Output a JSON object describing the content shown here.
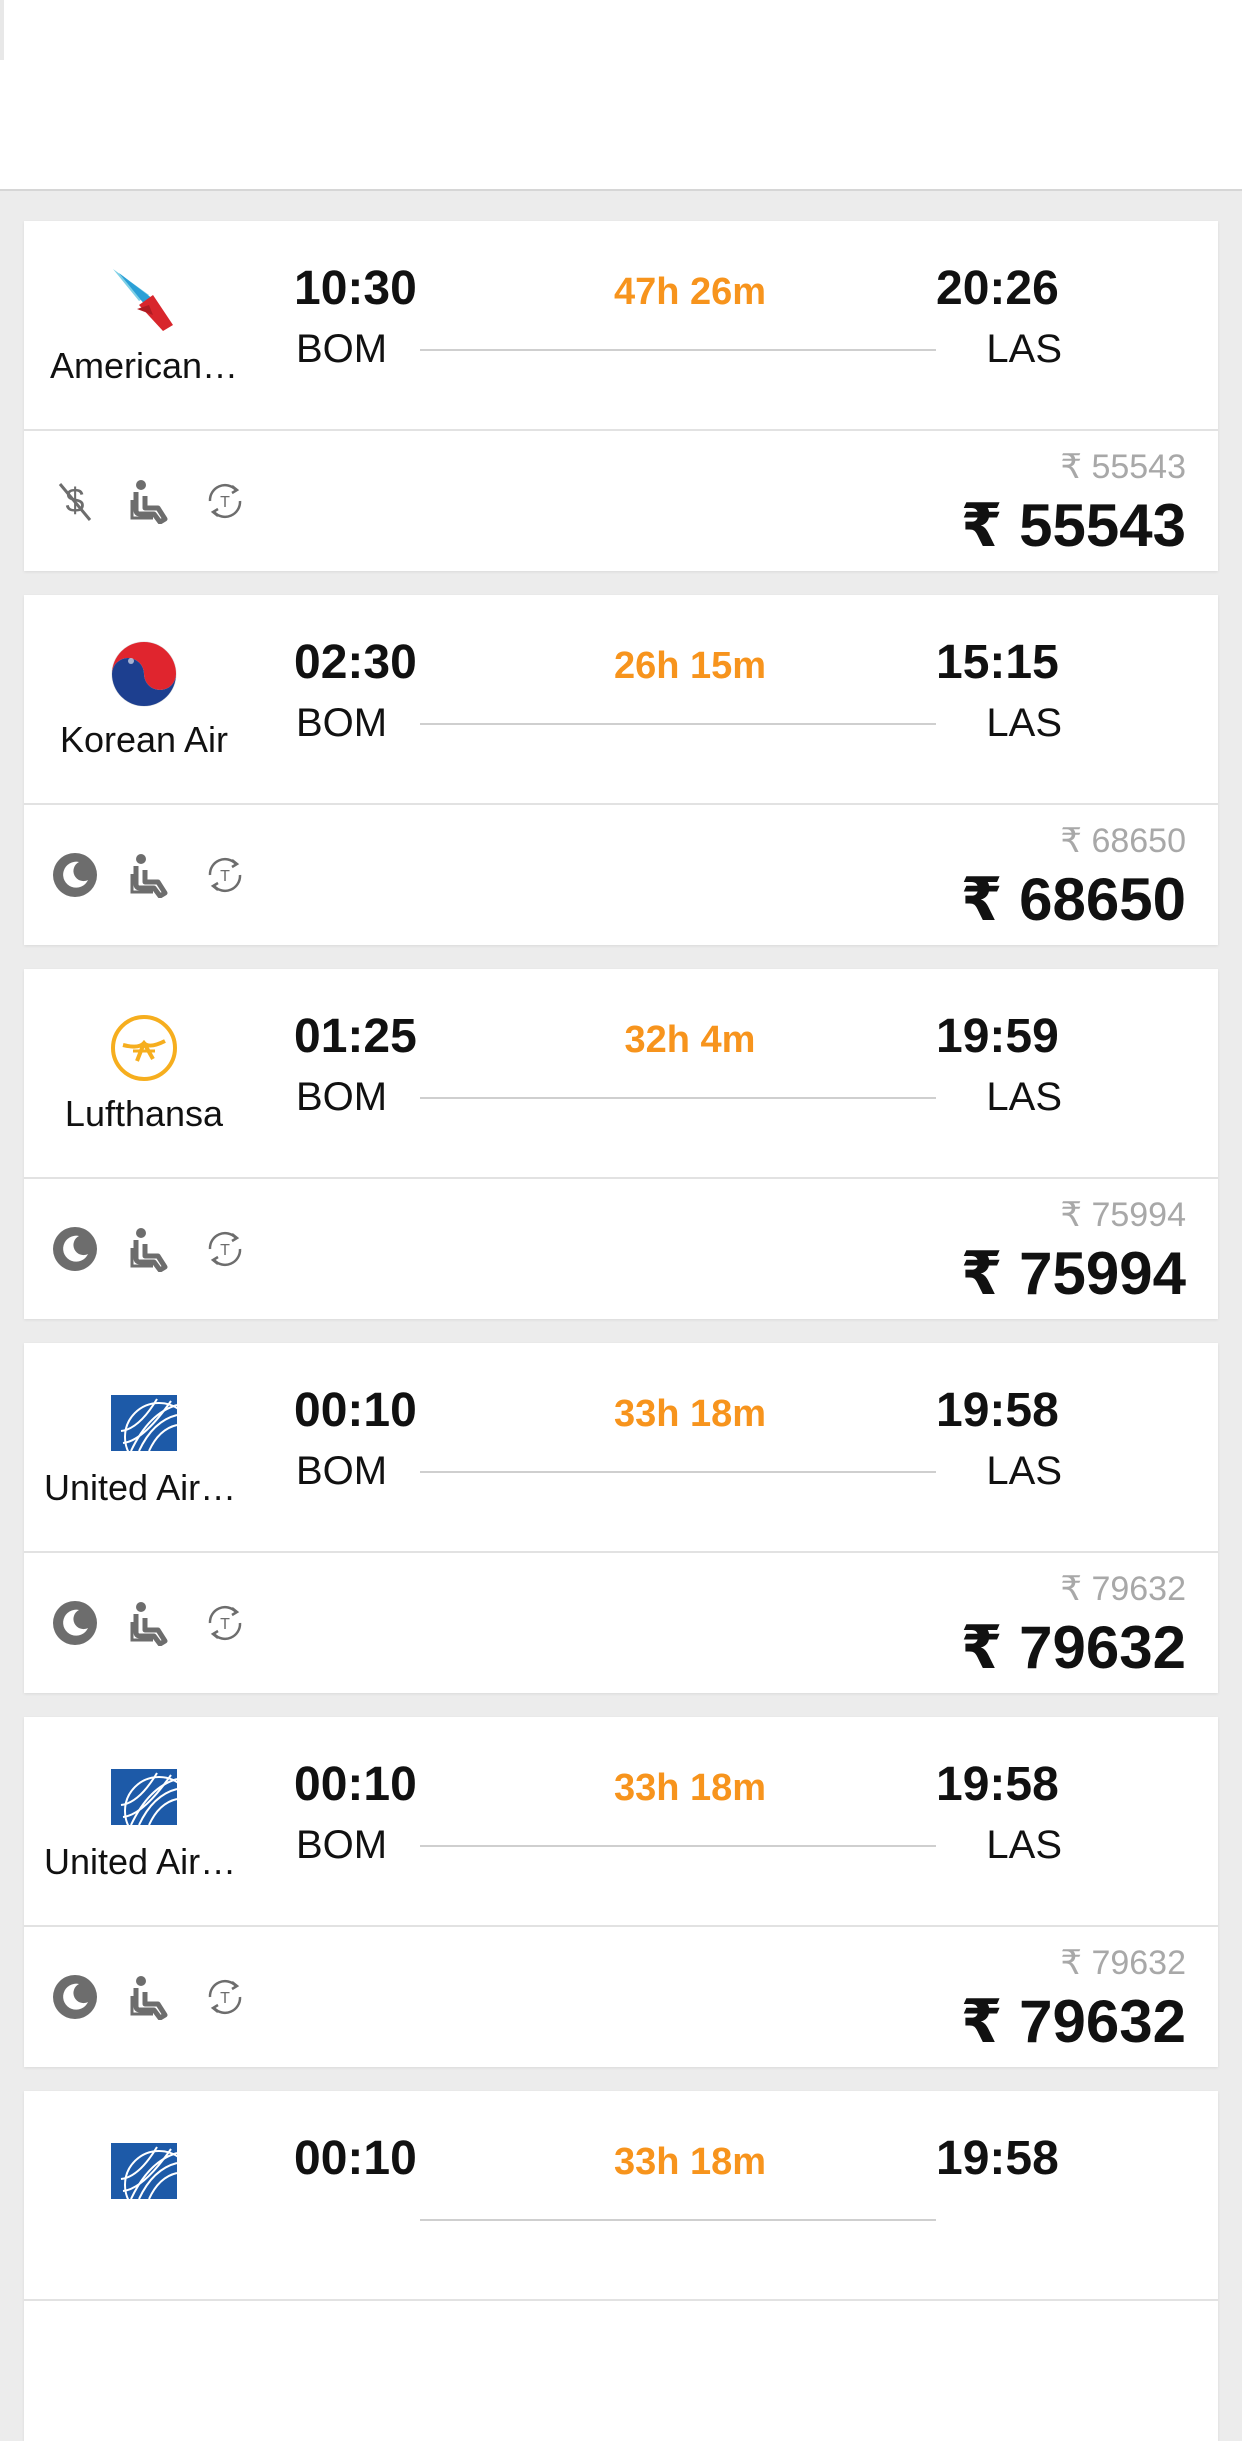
{
  "flights": [
    {
      "airline_name": "American…",
      "logo_icon": "american-airlines-logo-icon",
      "dep_time": "10:30",
      "dep_code": "BOM",
      "duration": "47h 26m",
      "arr_time": "20:26",
      "arr_code": "LAS",
      "feature_icons": [
        "non-refundable-icon",
        "seat-icon",
        "transit-icon"
      ],
      "price_original": "₹ 55543",
      "price": "₹ 55543"
    },
    {
      "airline_name": "Korean Air",
      "logo_icon": "korean-air-logo-icon",
      "dep_time": "02:30",
      "dep_code": "BOM",
      "duration": "26h 15m",
      "arr_time": "15:15",
      "arr_code": "LAS",
      "feature_icons": [
        "overnight-moon-icon",
        "seat-icon",
        "transit-icon"
      ],
      "price_original": "₹ 68650",
      "price": "₹ 68650"
    },
    {
      "airline_name": "Lufthansa",
      "logo_icon": "lufthansa-logo-icon",
      "dep_time": "01:25",
      "dep_code": "BOM",
      "duration": "32h 4m",
      "arr_time": "19:59",
      "arr_code": "LAS",
      "feature_icons": [
        "overnight-moon-icon",
        "seat-icon",
        "transit-icon"
      ],
      "price_original": "₹ 75994",
      "price": "₹ 75994"
    },
    {
      "airline_name": "United Airl…",
      "logo_icon": "united-airlines-logo-icon",
      "dep_time": "00:10",
      "dep_code": "BOM",
      "duration": "33h 18m",
      "arr_time": "19:58",
      "arr_code": "LAS",
      "feature_icons": [
        "overnight-moon-icon",
        "seat-icon",
        "transit-icon"
      ],
      "price_original": "₹ 79632",
      "price": "₹ 79632"
    },
    {
      "airline_name": "United Airl…",
      "logo_icon": "united-airlines-logo-icon",
      "dep_time": "00:10",
      "dep_code": "BOM",
      "duration": "33h 18m",
      "arr_time": "19:58",
      "arr_code": "LAS",
      "feature_icons": [
        "overnight-moon-icon",
        "seat-icon",
        "transit-icon"
      ],
      "price_original": "₹ 79632",
      "price": "₹ 79632"
    },
    {
      "airline_name": "",
      "logo_icon": "united-airlines-logo-icon",
      "dep_time": "00:10",
      "dep_code": "",
      "duration": "33h 18m",
      "arr_time": "19:58",
      "arr_code": "",
      "feature_icons": [],
      "price_original": "",
      "price": ""
    }
  ],
  "colors": {
    "duration": "#f7941d",
    "background": "#ececec",
    "card": "#ffffff",
    "icon_gray": "#6d6d6d"
  }
}
